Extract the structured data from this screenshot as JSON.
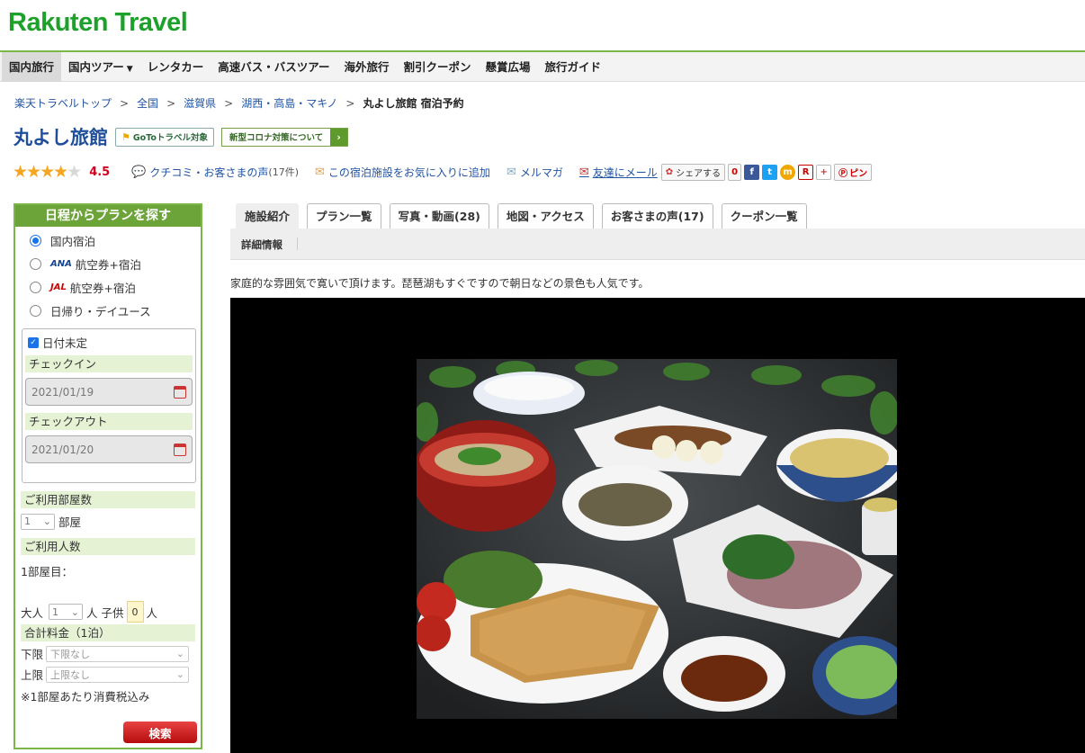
{
  "brand": {
    "logo_text": "Rakuten Travel"
  },
  "nav": {
    "items": [
      "国内旅行",
      "国内ツアー",
      "レンタカー",
      "高速バス・バスツアー",
      "海外旅行",
      "割引クーポン",
      "懸賞広場",
      "旅行ガイド"
    ],
    "caret": "▼"
  },
  "breadcrumb": {
    "items": [
      "楽天トラベルトップ",
      "全国",
      "滋賀県",
      "湖西・高島・マキノ"
    ],
    "separator": ">",
    "current": "丸よし旅館 宿泊予約"
  },
  "hotel": {
    "name": "丸よし旅館",
    "goto_badge": "GoToトラベル対象",
    "covid_badge": "新型コロナ対策について",
    "covid_arrow": "›",
    "rating": 4.5,
    "rating_text": "4.5",
    "stars_full": "★★★★",
    "stars_half": "★",
    "reviews_label": "クチコミ・お客さまの声",
    "reviews_count": "(17件)",
    "favorite_label": "この宿泊施設をお気に入りに追加",
    "mailmag_label": "メルマガ",
    "tell_friend_label": "友達にメール",
    "share_label": "シェアする",
    "share_count": "0",
    "pin_label": "ピン"
  },
  "sidebar": {
    "header": "日程からプランを探す",
    "options": [
      {
        "prefix": "",
        "label": "国内宿泊",
        "selected": true
      },
      {
        "prefix": "ANA",
        "label": "航空券+宿泊",
        "selected": false
      },
      {
        "prefix": "JAL",
        "label": "航空券+宿泊",
        "selected": false
      },
      {
        "prefix": "",
        "label": "日帰り・デイユース",
        "selected": false
      }
    ],
    "undecided_label": "日付未定",
    "checkin_label": "チェックイン",
    "checkin_value": "2021/01/19",
    "checkout_label": "チェックアウト",
    "checkout_value": "2021/01/20",
    "rooms_label": "ご利用部屋数",
    "rooms_value": "1",
    "rooms_unit": "部屋",
    "people_label": "ご利用人数",
    "room1_label": "1部屋目：",
    "adult_label": "大人",
    "adult_value": "1",
    "person_unit": "人",
    "child_label": "子供",
    "child_value": "0",
    "price_label": "合計料金（1泊）",
    "min_label": "下限",
    "min_value": "下限なし",
    "max_label": "上限",
    "max_value": "上限なし",
    "tax_note": "※1部屋あたり消費税込み",
    "search_button": "検索"
  },
  "tabs": [
    "施設紹介",
    "プラン一覧",
    "写真・動画(28)",
    "地図・アクセス",
    "お客さまの声(17)",
    "クーポン一覧"
  ],
  "subtab": "詳細情報",
  "intro_text": "家庭的な雰囲気で寛いで頂けます。琵琶湖もすぐですので朝日などの景色も人気です。",
  "colors": {
    "brand_green": "#1ea12b",
    "sidebar_green": "#6da43a",
    "link_blue": "#2255a4",
    "price_red": "#d0001e"
  }
}
